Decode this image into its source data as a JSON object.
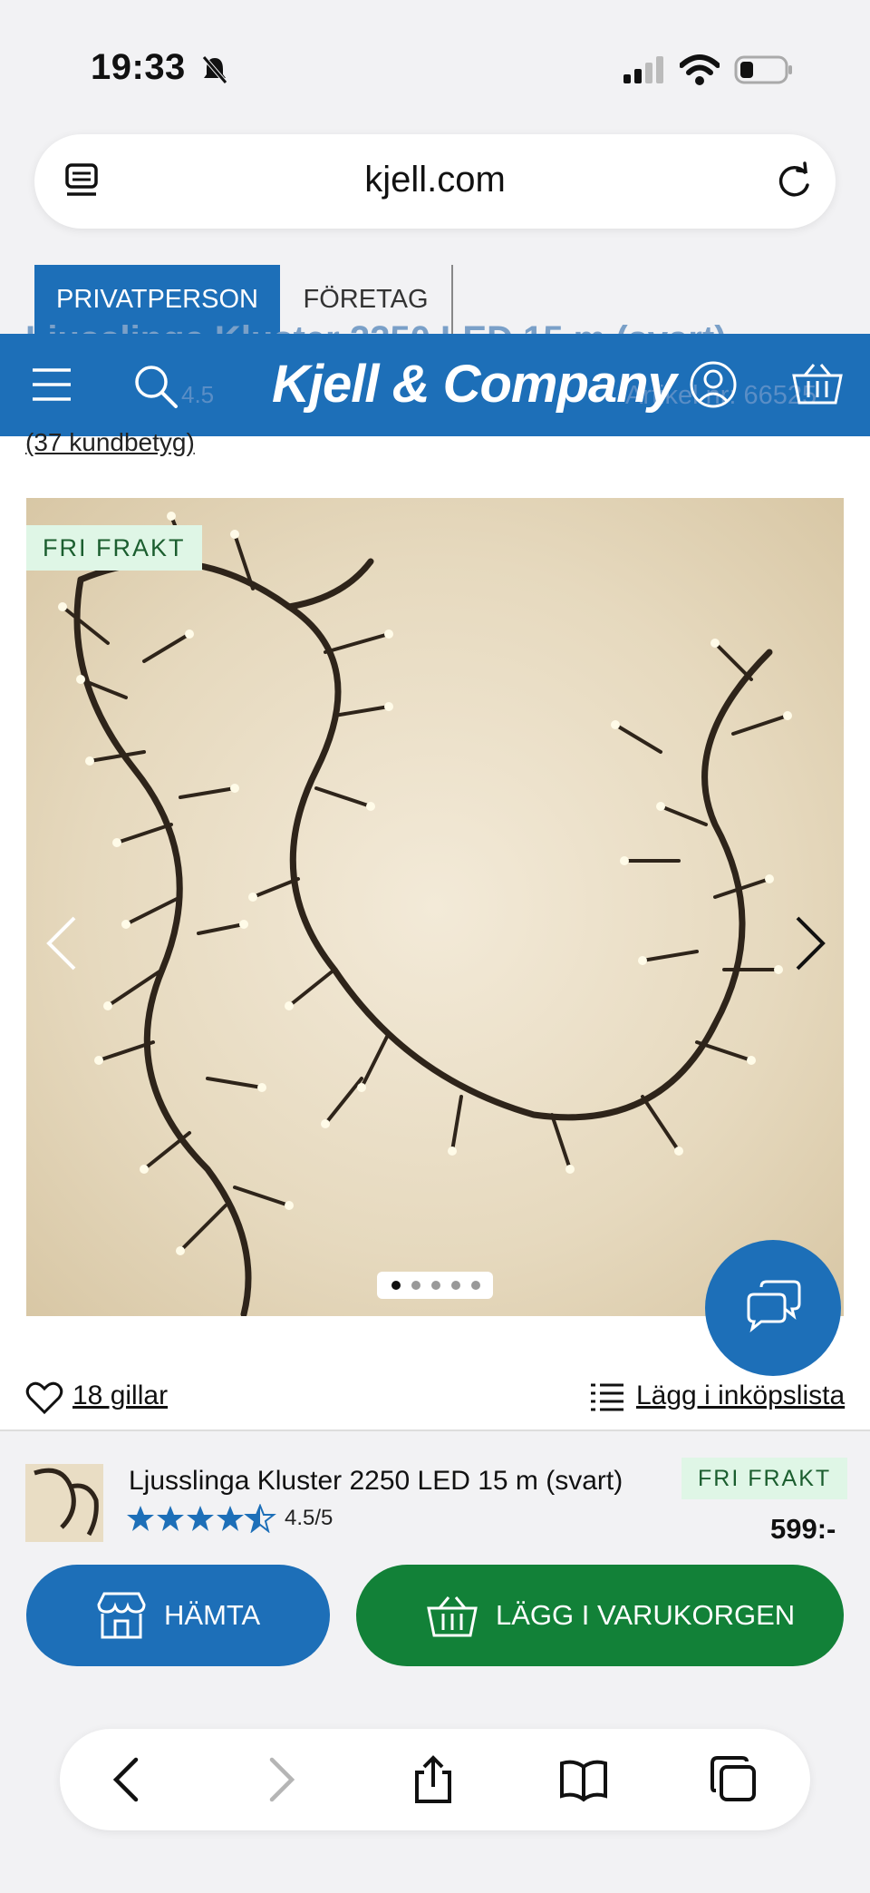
{
  "status_bar": {
    "time": "19:33"
  },
  "browser": {
    "url": "kjell.com"
  },
  "segments": {
    "private": "PRIVATPERSON",
    "business": "FÖRETAG"
  },
  "header": {
    "logo": "Kjell & Company",
    "ghost_title": "Ljusslinga Kluster 2250 LED 15 m (svart)",
    "ghost_rating": "4.5",
    "ghost_article": "Artikel nr: 66525",
    "reviews": "(37 kundbetyg)"
  },
  "gallery": {
    "badge": "FRI FRAKT",
    "slide_count": 5,
    "active_slide": 1
  },
  "actions": {
    "likes": "18 gillar",
    "shopping_list": "Lägg i inköpslista"
  },
  "sticky": {
    "product_name": "Ljusslinga Kluster 2250 LED 15 m (svart)",
    "rating": "4.5/5",
    "badge": "FRI FRAKT",
    "price": "599:-",
    "pickup_button": "HÄMTA",
    "cart_button": "LÄGG I VARUKORGEN"
  },
  "colors": {
    "brand_blue": "#1d6fb8",
    "cart_green": "#128138",
    "badge_bg": "#dff6e6"
  }
}
